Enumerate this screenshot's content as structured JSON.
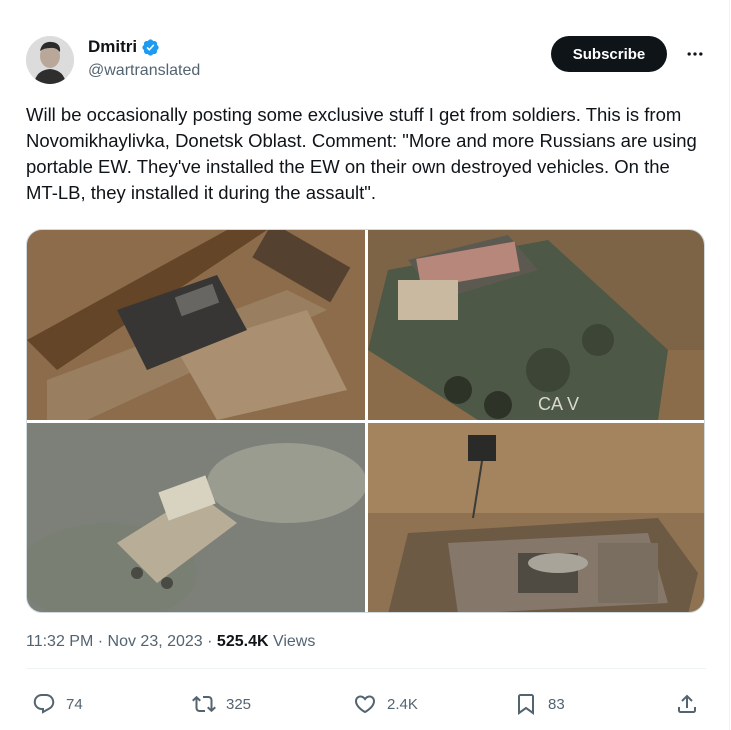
{
  "author": {
    "name": "Dmitri",
    "handle": "@wartranslated",
    "verified_color": "#1d9bf0"
  },
  "subscribe_label": "Subscribe",
  "post_text": "Will be occasionally posting some exclusive stuff I get from soldiers. This is from Novomikhaylivka, Donetsk Oblast. Comment: \"More and more Russians are using portable EW. They've installed the EW on their own destroyed vehicles. On the MT-LB, they installed it during the assault\".",
  "meta": {
    "time": "11:32 PM",
    "dot": " · ",
    "date": "Nov 23, 2023",
    "dot2": " · ",
    "views_count": "525.4K",
    "views_label": " Views"
  },
  "actions": {
    "replies": "74",
    "reposts": "325",
    "likes": "2.4K",
    "bookmarks": "83"
  },
  "colors": {
    "text": "#0f1419",
    "secondary": "#536471",
    "border": "#cfd9de"
  },
  "icons": [
    "verified-badge-icon",
    "more-icon",
    "reply-icon",
    "repost-icon",
    "like-icon",
    "bookmark-icon",
    "share-icon"
  ]
}
